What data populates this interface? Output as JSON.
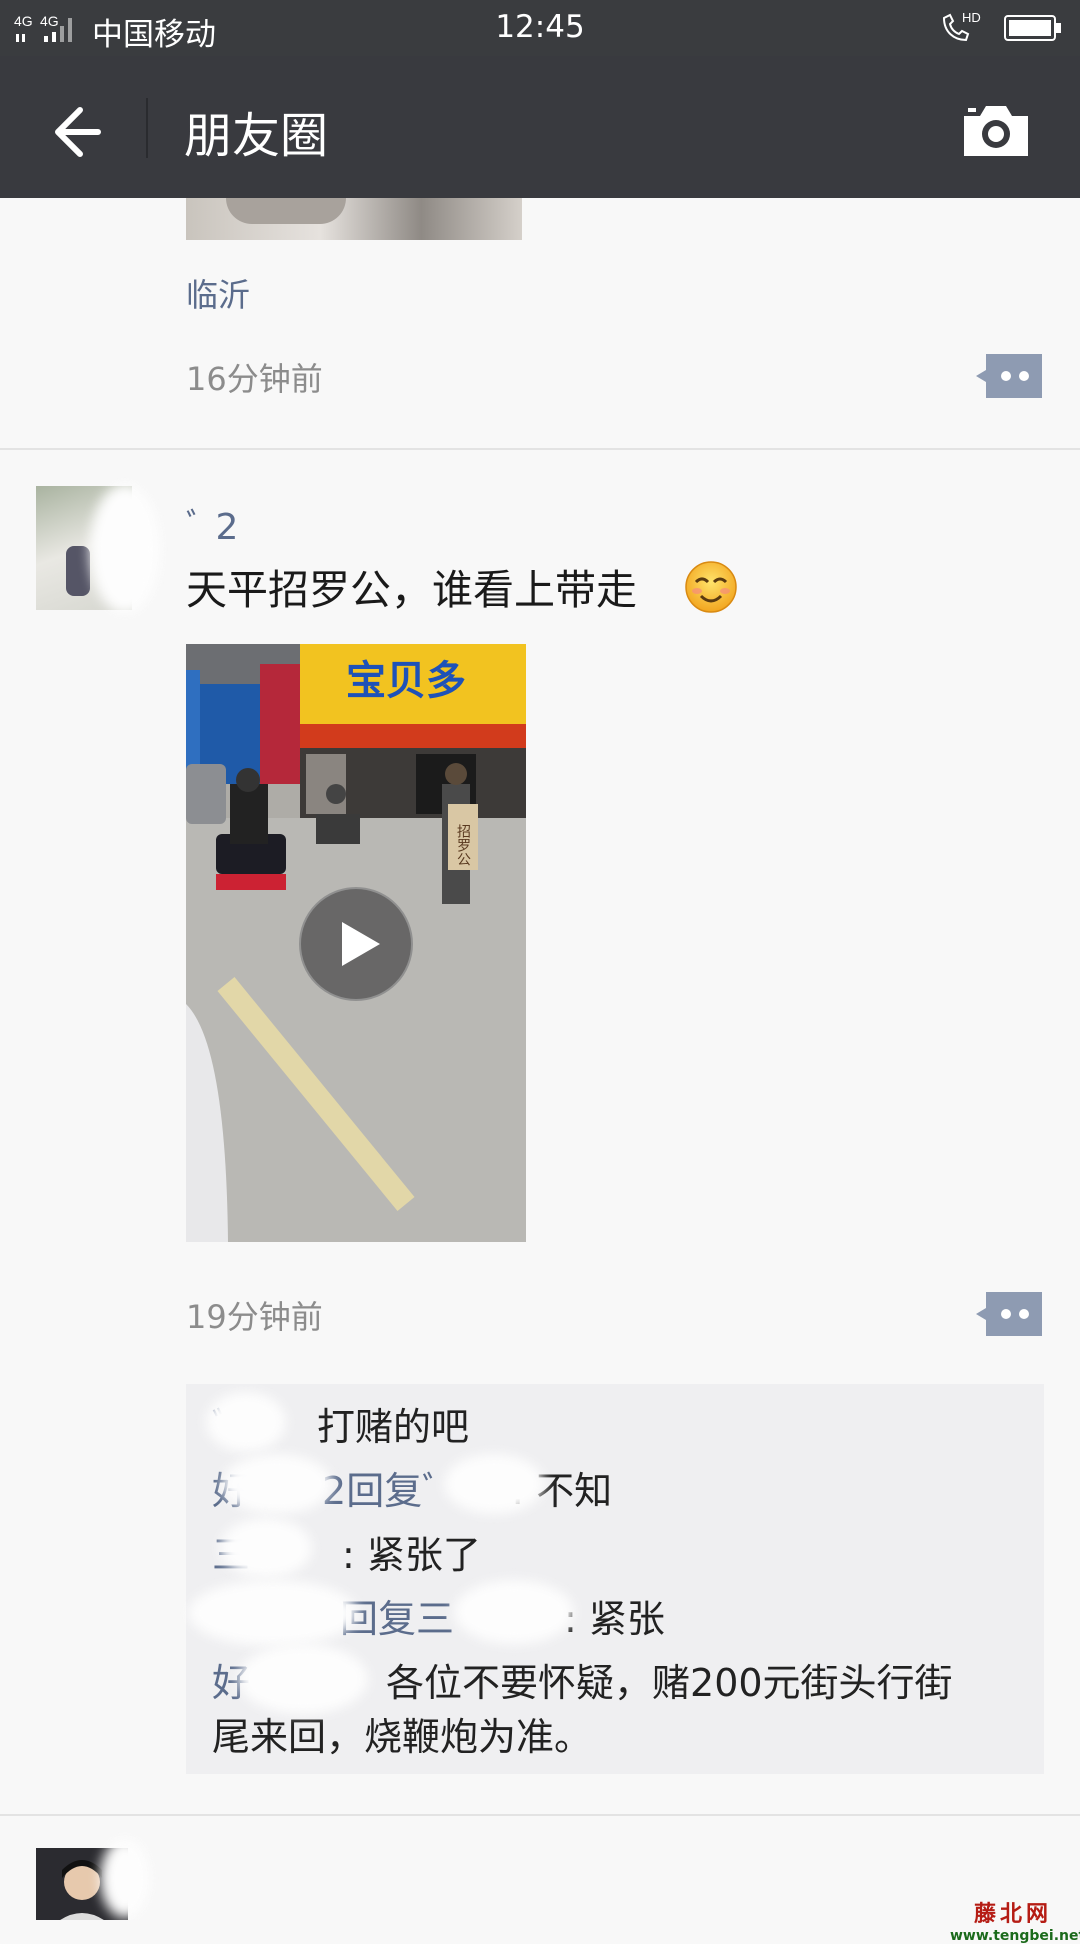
{
  "status_bar": {
    "network": "4G 4G",
    "carrier": "中国移动",
    "time": "12:45",
    "hd_label": "HD"
  },
  "header": {
    "title": "朋友圈",
    "back_icon": "arrow-left-icon",
    "camera_icon": "camera-icon"
  },
  "feed": {
    "previous_post": {
      "location": "临沂",
      "time": "16分钟前"
    },
    "post": {
      "username_visible": "ﾞ          2",
      "text": "天平招罗公，谁看上带走",
      "emoji": "smirk-emoji",
      "video": {
        "sign_text": "招罗公",
        "store_sign": "宝贝多"
      },
      "time": "19分钟前",
      "comments": [
        {
          "name": "ﾞ",
          "sep": "",
          "text": "打赌的吧"
        },
        {
          "name": "好",
          "sep": "2回复",
          "reply_to": "ﾞ",
          "text": ": 不知"
        },
        {
          "name": "三",
          "sep": "",
          "text": ": 紧张了"
        },
        {
          "name": "",
          "sep": "回复三",
          "reply_to": "",
          "text": ":  紧张"
        },
        {
          "name": "好",
          "sep": "",
          "text": "各位不要怀疑，赌200元街头行街",
          "text2": "尾来回，烧鞭炮为准。"
        }
      ]
    }
  },
  "watermark": {
    "site_cn": "藤北网",
    "url": "www.tengbei.net"
  },
  "colors": {
    "titlebar": "#393a3f",
    "link": "#5b6c8c",
    "comment_bg": "#efeff1"
  }
}
